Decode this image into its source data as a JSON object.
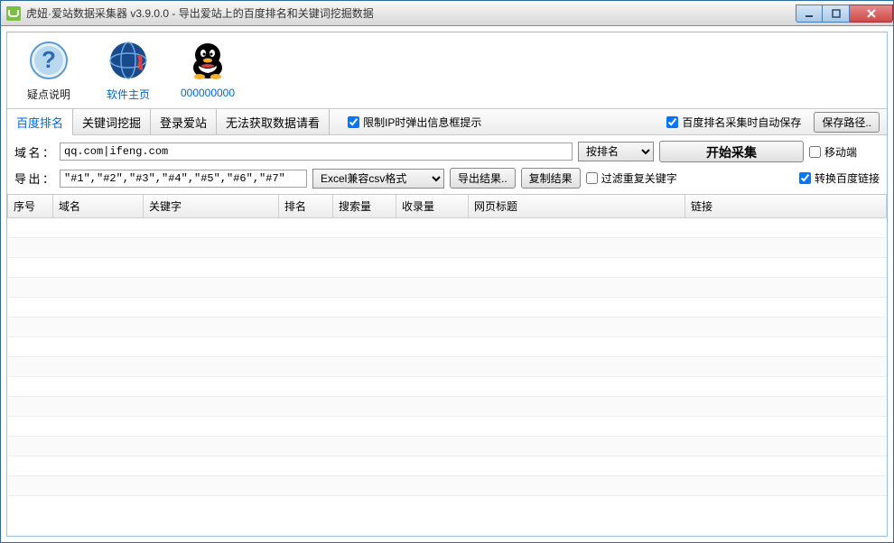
{
  "window": {
    "title": "虎妞·爱站数据采集器 v3.9.0.0 - 导出爱站上的百度排名和关键词挖掘数据"
  },
  "toolbarIcons": {
    "help": "疑点说明",
    "home": "软件主页",
    "qq": "000000000"
  },
  "tabs": {
    "baidu": "百度排名",
    "keyword": "关键词挖掘",
    "login": "登录爱站",
    "cannot": "无法获取数据请看"
  },
  "tabOptions": {
    "limitIp": "限制IP时弹出信息框提示",
    "autoSave": "百度排名采集时自动保存",
    "savePath": "保存路径.."
  },
  "form": {
    "domainLabel": "域名：",
    "domainValue": "qq.com|ifeng.com",
    "sortSelect": "按排名",
    "startBtn": "开始采集",
    "mobile": "移动端",
    "exportLabel": "导出：",
    "exportTemplate": "\"#1\",\"#2\",\"#3\",\"#4\",\"#5\",\"#6\",\"#7\"",
    "formatSelect": "Excel兼容csv格式",
    "exportBtn": "导出结果..",
    "copyBtn": "复制结果",
    "filterDup": "过滤重复关键字",
    "convertLink": "转换百度链接"
  },
  "columns": {
    "seq": "序号",
    "domain": "域名",
    "keyword": "关键字",
    "rank": "排名",
    "search": "搜索量",
    "indexed": "收录量",
    "title": "网页标题",
    "link": "链接"
  },
  "checked": {
    "limitIp": true,
    "autoSave": true,
    "mobile": false,
    "filterDup": false,
    "convertLink": true
  }
}
